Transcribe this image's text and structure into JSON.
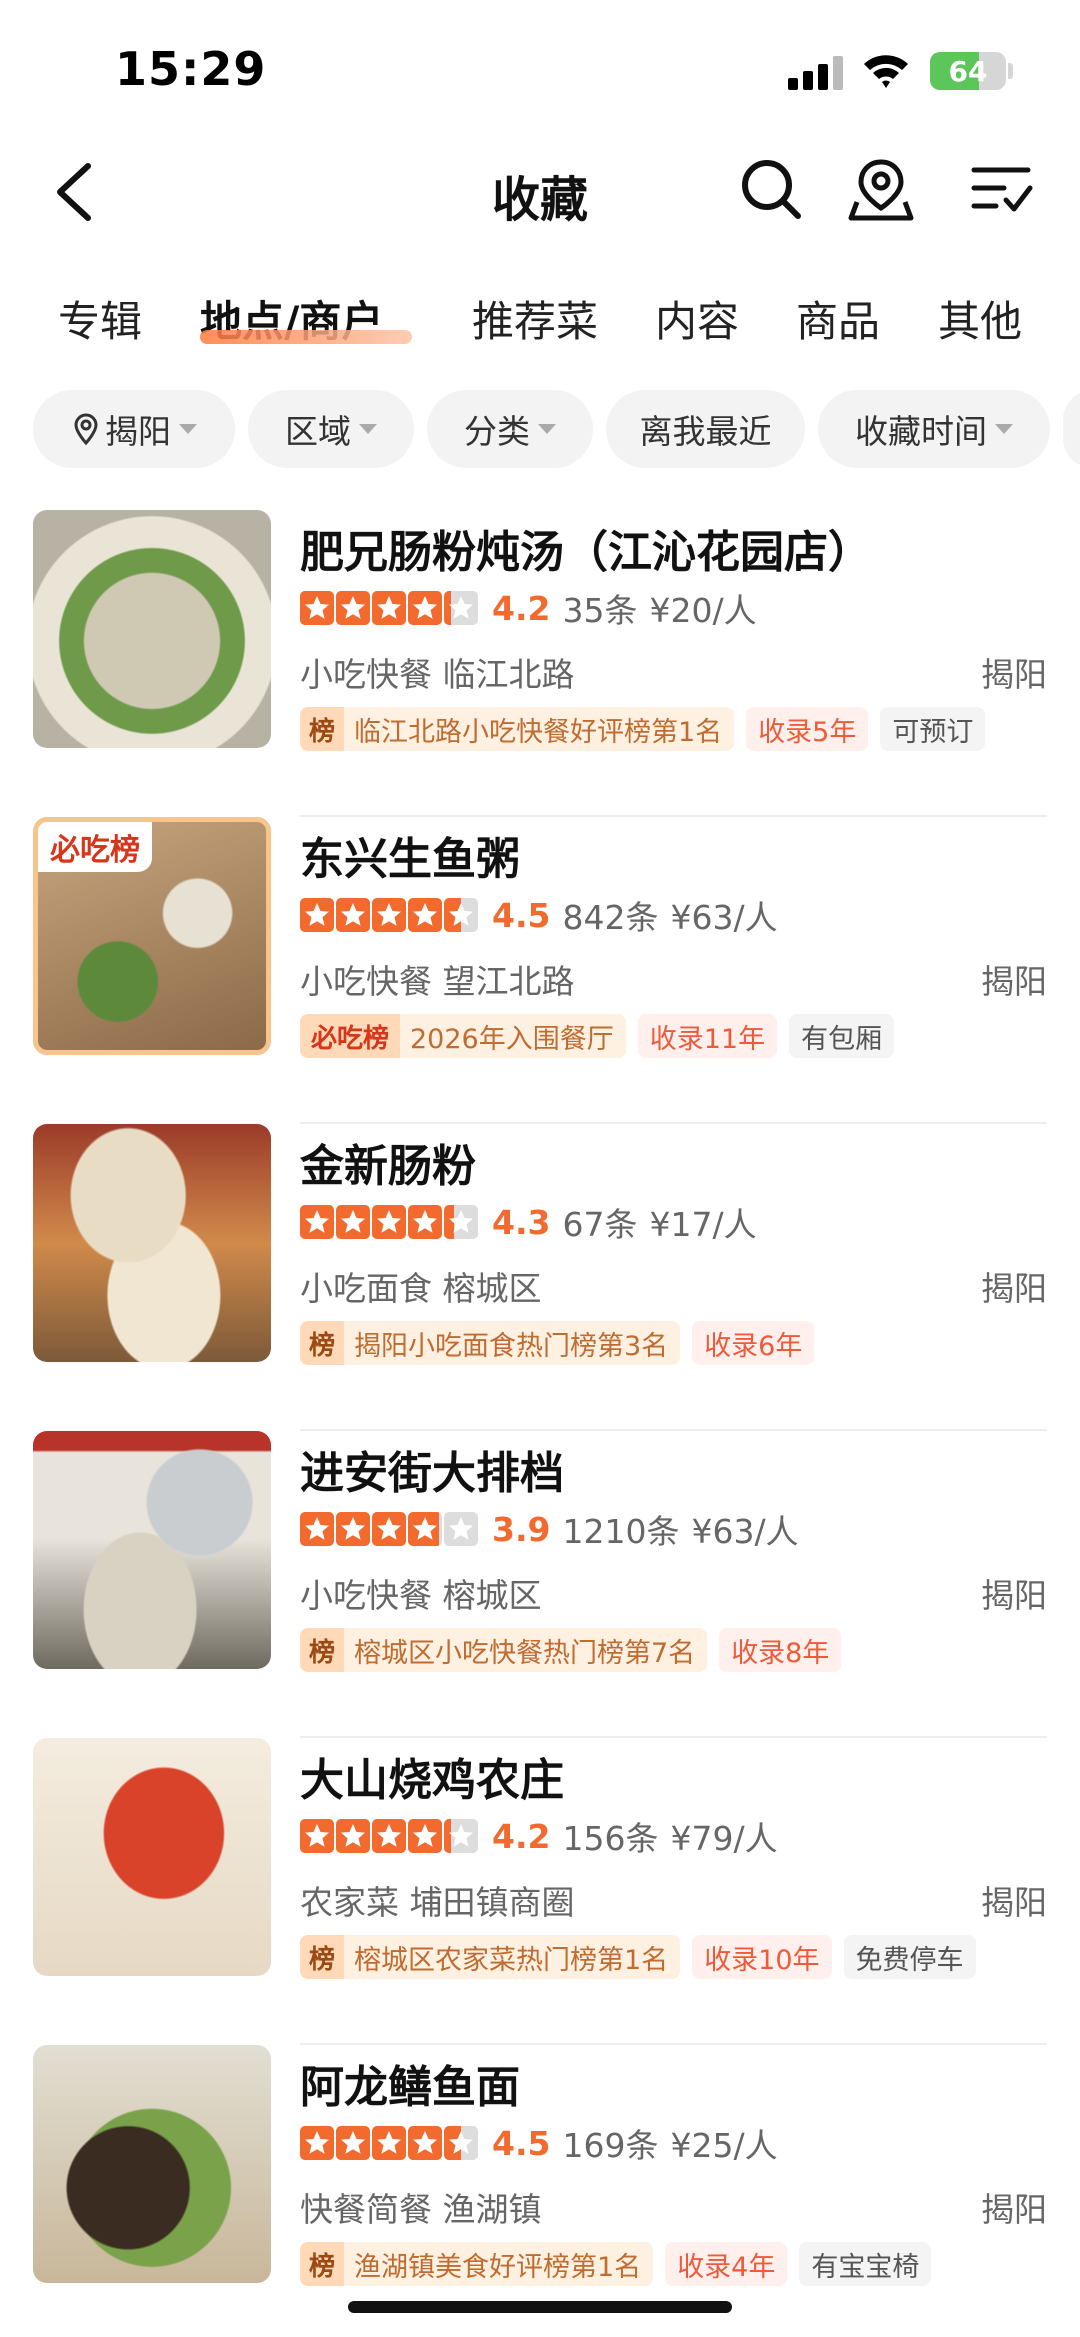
{
  "status": {
    "time": "15:29",
    "battery": "64",
    "battery_level": 0.64
  },
  "nav": {
    "title": "收藏",
    "icons": [
      "back-icon",
      "search-icon",
      "map-pin-icon",
      "sort-list-icon"
    ]
  },
  "tabs": [
    {
      "label": "专辑"
    },
    {
      "label": "地点/商户"
    },
    {
      "label": "推荐菜"
    },
    {
      "label": "内容"
    },
    {
      "label": "商品"
    },
    {
      "label": "其他"
    }
  ],
  "filters": {
    "location": "揭阳",
    "area": "区域",
    "category": "分类",
    "nearest": "离我最近",
    "saved_time": "收藏时间"
  },
  "colors": {
    "accent": "#f26a2e",
    "rank_tag_bg": "#fff1e2",
    "years_tag_text": "#ef5b3a"
  },
  "items": [
    {
      "name": "肥兄肠粉炖汤（江沁花园店）",
      "rating": 4.2,
      "score": "4.2",
      "reviews": "35条",
      "price": "¥20/人",
      "category": "小吃快餐 临江北路",
      "city": "揭阳",
      "rank_mark": "榜",
      "rank_text": "临江北路小吃快餐好评榜第1名",
      "years": "收录5年",
      "feature": "可预订"
    },
    {
      "name": "东兴生鱼粥",
      "rating": 4.5,
      "score": "4.5",
      "reviews": "842条",
      "price": "¥63/人",
      "category": "小吃快餐 望江北路",
      "city": "揭阳",
      "thumb_badge": "必吃榜",
      "rank_mark": "必吃榜",
      "rank_text": "2026年入围餐厅",
      "years": "收录11年",
      "feature": "有包厢"
    },
    {
      "name": "金新肠粉",
      "rating": 4.3,
      "score": "4.3",
      "reviews": "67条",
      "price": "¥17/人",
      "category": "小吃面食 榕城区",
      "city": "揭阳",
      "rank_mark": "榜",
      "rank_text": "揭阳小吃面食热门榜第3名",
      "years": "收录6年",
      "feature": ""
    },
    {
      "name": "进安街大排档",
      "rating": 3.9,
      "score": "3.9",
      "reviews": "1210条",
      "price": "¥63/人",
      "category": "小吃快餐 榕城区",
      "city": "揭阳",
      "rank_mark": "榜",
      "rank_text": "榕城区小吃快餐热门榜第7名",
      "years": "收录8年",
      "feature": ""
    },
    {
      "name": "大山烧鸡农庄",
      "rating": 4.2,
      "score": "4.2",
      "reviews": "156条",
      "price": "¥79/人",
      "category": "农家菜 埔田镇商圈",
      "city": "揭阳",
      "rank_mark": "榜",
      "rank_text": "榕城区农家菜热门榜第1名",
      "years": "收录10年",
      "feature": "免费停车"
    },
    {
      "name": "阿龙鳝鱼面",
      "rating": 4.5,
      "score": "4.5",
      "reviews": "169条",
      "price": "¥25/人",
      "category": "快餐简餐 渔湖镇",
      "city": "揭阳",
      "rank_mark": "榜",
      "rank_text": "渔湖镇美食好评榜第1名",
      "years": "收录4年",
      "feature": "有宝宝椅"
    }
  ]
}
